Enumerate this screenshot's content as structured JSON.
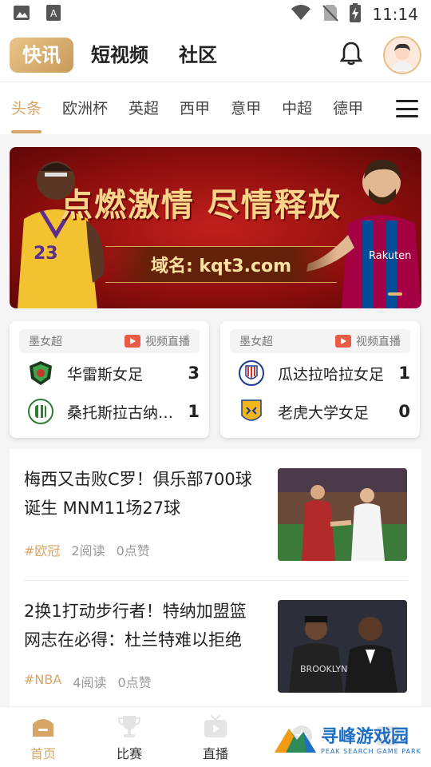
{
  "status_bar": {
    "time": "11:14"
  },
  "top_tabs": [
    {
      "label": "快讯",
      "active": true
    },
    {
      "label": "短视频",
      "active": false
    },
    {
      "label": "社区",
      "active": false
    }
  ],
  "categories": [
    {
      "label": "头条",
      "active": true
    },
    {
      "label": "欧洲杯"
    },
    {
      "label": "英超"
    },
    {
      "label": "西甲"
    },
    {
      "label": "意甲"
    },
    {
      "label": "中超"
    },
    {
      "label": "德甲"
    }
  ],
  "banner": {
    "title": "点燃激情 尽情释放",
    "domain": "域名: kqt3.com"
  },
  "matches": [
    {
      "league": "墨女超",
      "live_label": "视频直播",
      "home": {
        "name": "华雷斯女足",
        "score": "3"
      },
      "away": {
        "name": "桑托斯拉古纳女足",
        "score": "1"
      }
    },
    {
      "league": "墨女超",
      "live_label": "视频直播",
      "home": {
        "name": "瓜达拉哈拉女足",
        "score": "1"
      },
      "away": {
        "name": "老虎大学女足",
        "score": "0"
      }
    }
  ],
  "news": [
    {
      "title": "梅西又击败C罗！俱乐部700球诞生 MNM11场27球",
      "tag": "#欧冠",
      "reads": "2阅读",
      "likes": "0点赞"
    },
    {
      "title": "2换1打动步行者！特纳加盟篮网志在必得：杜兰特难以拒绝",
      "tag": "#NBA",
      "reads": "4阅读",
      "likes": "0点赞"
    }
  ],
  "bottom_nav": [
    {
      "label": "首页",
      "active": true
    },
    {
      "label": "比赛"
    },
    {
      "label": "直播"
    },
    {
      "label": ""
    },
    {
      "label": ""
    }
  ],
  "watermark": {
    "main": "寻峰游戏园",
    "sub": "PEAK SEARCH GAME PARK"
  },
  "colors": {
    "accent": "#d7a667",
    "live_red": "#ea5b45",
    "banner_red": "#a8140f"
  }
}
